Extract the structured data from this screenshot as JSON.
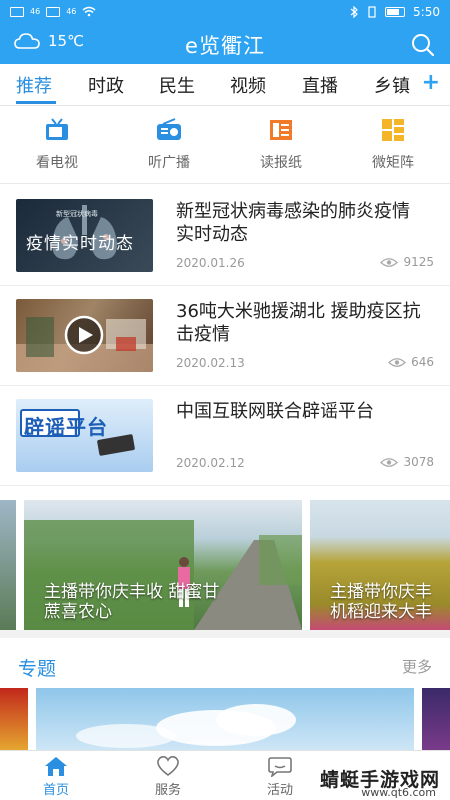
{
  "status": {
    "signal_left": "46",
    "signal_right": "46",
    "battery": "",
    "time": "5:50"
  },
  "header": {
    "temperature": "15℃",
    "app_title": "e览衢江"
  },
  "tabs": [
    {
      "label": "推荐",
      "active": true
    },
    {
      "label": "时政"
    },
    {
      "label": "民生"
    },
    {
      "label": "视频"
    },
    {
      "label": "直播"
    },
    {
      "label": "乡镇"
    }
  ],
  "tabs_add": "+",
  "quick_links": [
    {
      "label": "看电视",
      "icon": "tv-icon"
    },
    {
      "label": "听广播",
      "icon": "radio-icon"
    },
    {
      "label": "读报纸",
      "icon": "newspaper-icon"
    },
    {
      "label": "微矩阵",
      "icon": "grid-icon"
    }
  ],
  "news": [
    {
      "title": "新型冠状病毒感染的肺炎疫情实时动态",
      "date": "2020.01.26",
      "views": "9125",
      "thumb_text": "疫情实时动态",
      "thumb_subtext": "新型冠状病毒"
    },
    {
      "title": " 36吨大米驰援湖北  援助疫区抗击疫情",
      "date": "2020.02.13",
      "views": "646"
    },
    {
      "title": "中国互联网联合辟谣平台",
      "date": "2020.02.12",
      "views": "3078",
      "thumb_text": "辟谣平台"
    }
  ],
  "carousel": [
    {
      "caption_line1": "主播带你庆丰收  甜蜜甘",
      "caption_line2": "蔗喜农心"
    },
    {
      "caption_line1": "主播带你庆丰",
      "caption_line2": "机稻迎来大丰"
    }
  ],
  "topics": {
    "title": "专题",
    "more": "更多"
  },
  "bottom_nav": [
    {
      "label": "首页",
      "icon": "home-icon",
      "active": true
    },
    {
      "label": "服务",
      "icon": "heart-icon"
    },
    {
      "label": "活动",
      "icon": "chat-icon"
    }
  ],
  "watermark": {
    "text": "蜻蜓手游戏网",
    "url": "www.qt6.com"
  },
  "colors": {
    "brand_blue": "#2ea3f2",
    "active_blue": "#2a8fe0"
  }
}
